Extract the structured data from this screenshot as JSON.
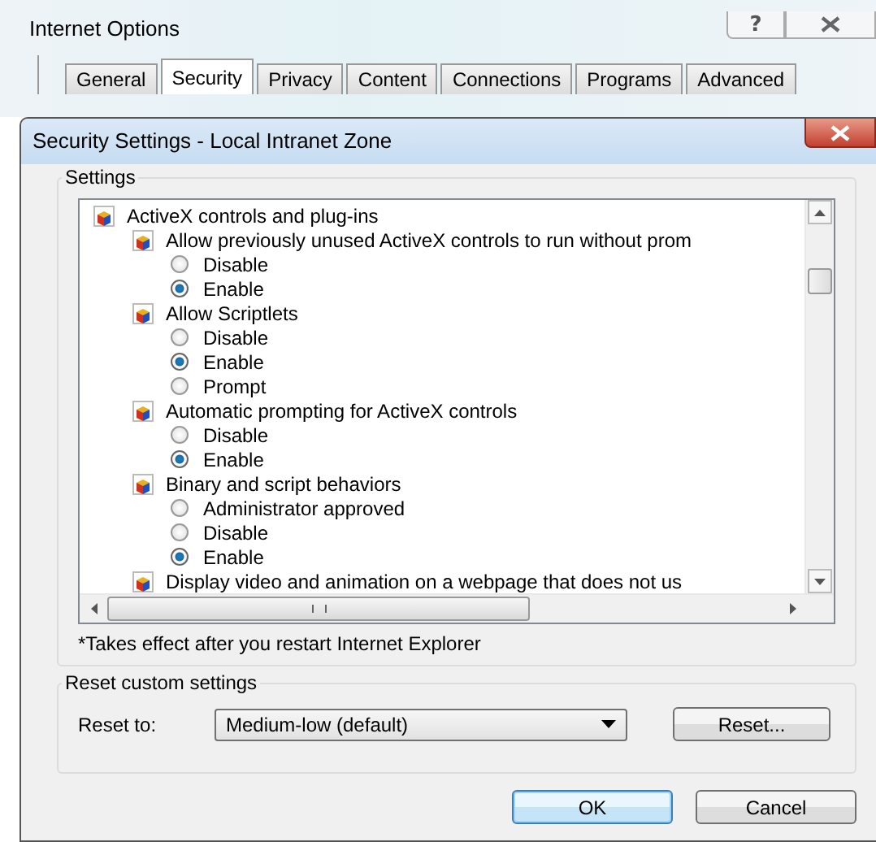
{
  "background_window": {
    "title": "Internet Options",
    "help_button": "?",
    "tabs": [
      {
        "label": "General",
        "selected": false
      },
      {
        "label": "Security",
        "selected": true
      },
      {
        "label": "Privacy",
        "selected": false
      },
      {
        "label": "Content",
        "selected": false
      },
      {
        "label": "Connections",
        "selected": false
      },
      {
        "label": "Programs",
        "selected": false
      },
      {
        "label": "Advanced",
        "selected": false
      }
    ]
  },
  "dialog": {
    "title": "Security Settings - Local Intranet Zone",
    "settings_group": {
      "label": "Settings",
      "tree": [
        {
          "label": "ActiveX controls and plug-ins",
          "children": [
            {
              "label": "Allow previously unused ActiveX controls to run without prom",
              "options": [
                {
                  "label": "Disable",
                  "selected": false
                },
                {
                  "label": "Enable",
                  "selected": true
                }
              ]
            },
            {
              "label": "Allow Scriptlets",
              "options": [
                {
                  "label": "Disable",
                  "selected": false
                },
                {
                  "label": "Enable",
                  "selected": true
                },
                {
                  "label": "Prompt",
                  "selected": false
                }
              ]
            },
            {
              "label": "Automatic prompting for ActiveX controls",
              "options": [
                {
                  "label": "Disable",
                  "selected": false
                },
                {
                  "label": "Enable",
                  "selected": true
                }
              ]
            },
            {
              "label": "Binary and script behaviors",
              "options": [
                {
                  "label": "Administrator approved",
                  "selected": false
                },
                {
                  "label": "Disable",
                  "selected": false
                },
                {
                  "label": "Enable",
                  "selected": true
                }
              ]
            },
            {
              "label": "Display video and animation on a webpage that does not us"
            }
          ]
        }
      ],
      "note": "*Takes effect after you restart Internet Explorer"
    },
    "reset_group": {
      "label": "Reset custom settings",
      "reset_to_label": "Reset to:",
      "dropdown_value": "Medium-low (default)",
      "reset_button": "Reset..."
    },
    "buttons": [
      {
        "label": "OK",
        "default": true
      },
      {
        "label": "Cancel",
        "default": false
      }
    ]
  }
}
